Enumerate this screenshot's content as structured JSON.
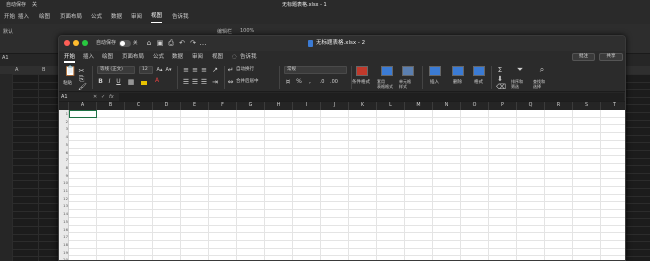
{
  "background_window": {
    "autosave_label": "自动保存",
    "autosave_state": "关",
    "title": "无标题表格.xlsx - 1",
    "tabs": [
      "开始",
      "插入",
      "绘图",
      "页面布局",
      "公式",
      "数据",
      "审阅",
      "视图",
      "告诉我"
    ],
    "active_tab": "视图",
    "ribbon_items": [
      "默认",
      "编辑栏",
      "100%",
      "网格"
    ],
    "name_box": "A1",
    "columns": [
      "A",
      "B"
    ]
  },
  "window": {
    "autosave_label": "自动保存",
    "autosave_state": "关",
    "title": "无标题表格.xlsx - 2",
    "tabs": [
      "开始",
      "插入",
      "绘图",
      "页面布局",
      "公式",
      "数据",
      "审阅",
      "视图",
      "告诉我"
    ],
    "active_tab_index": 0,
    "comment_button": "批注",
    "share_button": "共享",
    "ribbon": {
      "paste": "粘贴",
      "font_name": "等线 (正文)",
      "font_size": "12",
      "wrap_text": "自动换行",
      "merge_center": "合并后居中",
      "number_format": "常规",
      "conditional_format": "条件格式",
      "format_as_table": "套用\n表格格式",
      "cell_styles": "单元格\n样式",
      "insert": "插入",
      "delete": "删除",
      "format": "格式",
      "sort_filter": "排序和\n筛选",
      "find_select": "查找和\n选择",
      "bold": "B",
      "italic": "I",
      "underline": "U"
    },
    "name_box": "A1",
    "formula_fx": "fx",
    "columns": [
      "A",
      "B",
      "C",
      "D",
      "E",
      "F",
      "G",
      "H",
      "I",
      "J",
      "K",
      "L",
      "M",
      "N",
      "O",
      "P",
      "Q",
      "R",
      "S",
      "T"
    ],
    "rows": [
      "1",
      "2",
      "3",
      "4",
      "5",
      "6",
      "7",
      "8",
      "9",
      "10",
      "11",
      "12",
      "13",
      "14",
      "15",
      "16",
      "17",
      "18",
      "19",
      "20"
    ],
    "selected_cell": "A1",
    "colors": {
      "accent_green": "#1e7145",
      "title_icon_blue": "#3b7bd4"
    }
  }
}
